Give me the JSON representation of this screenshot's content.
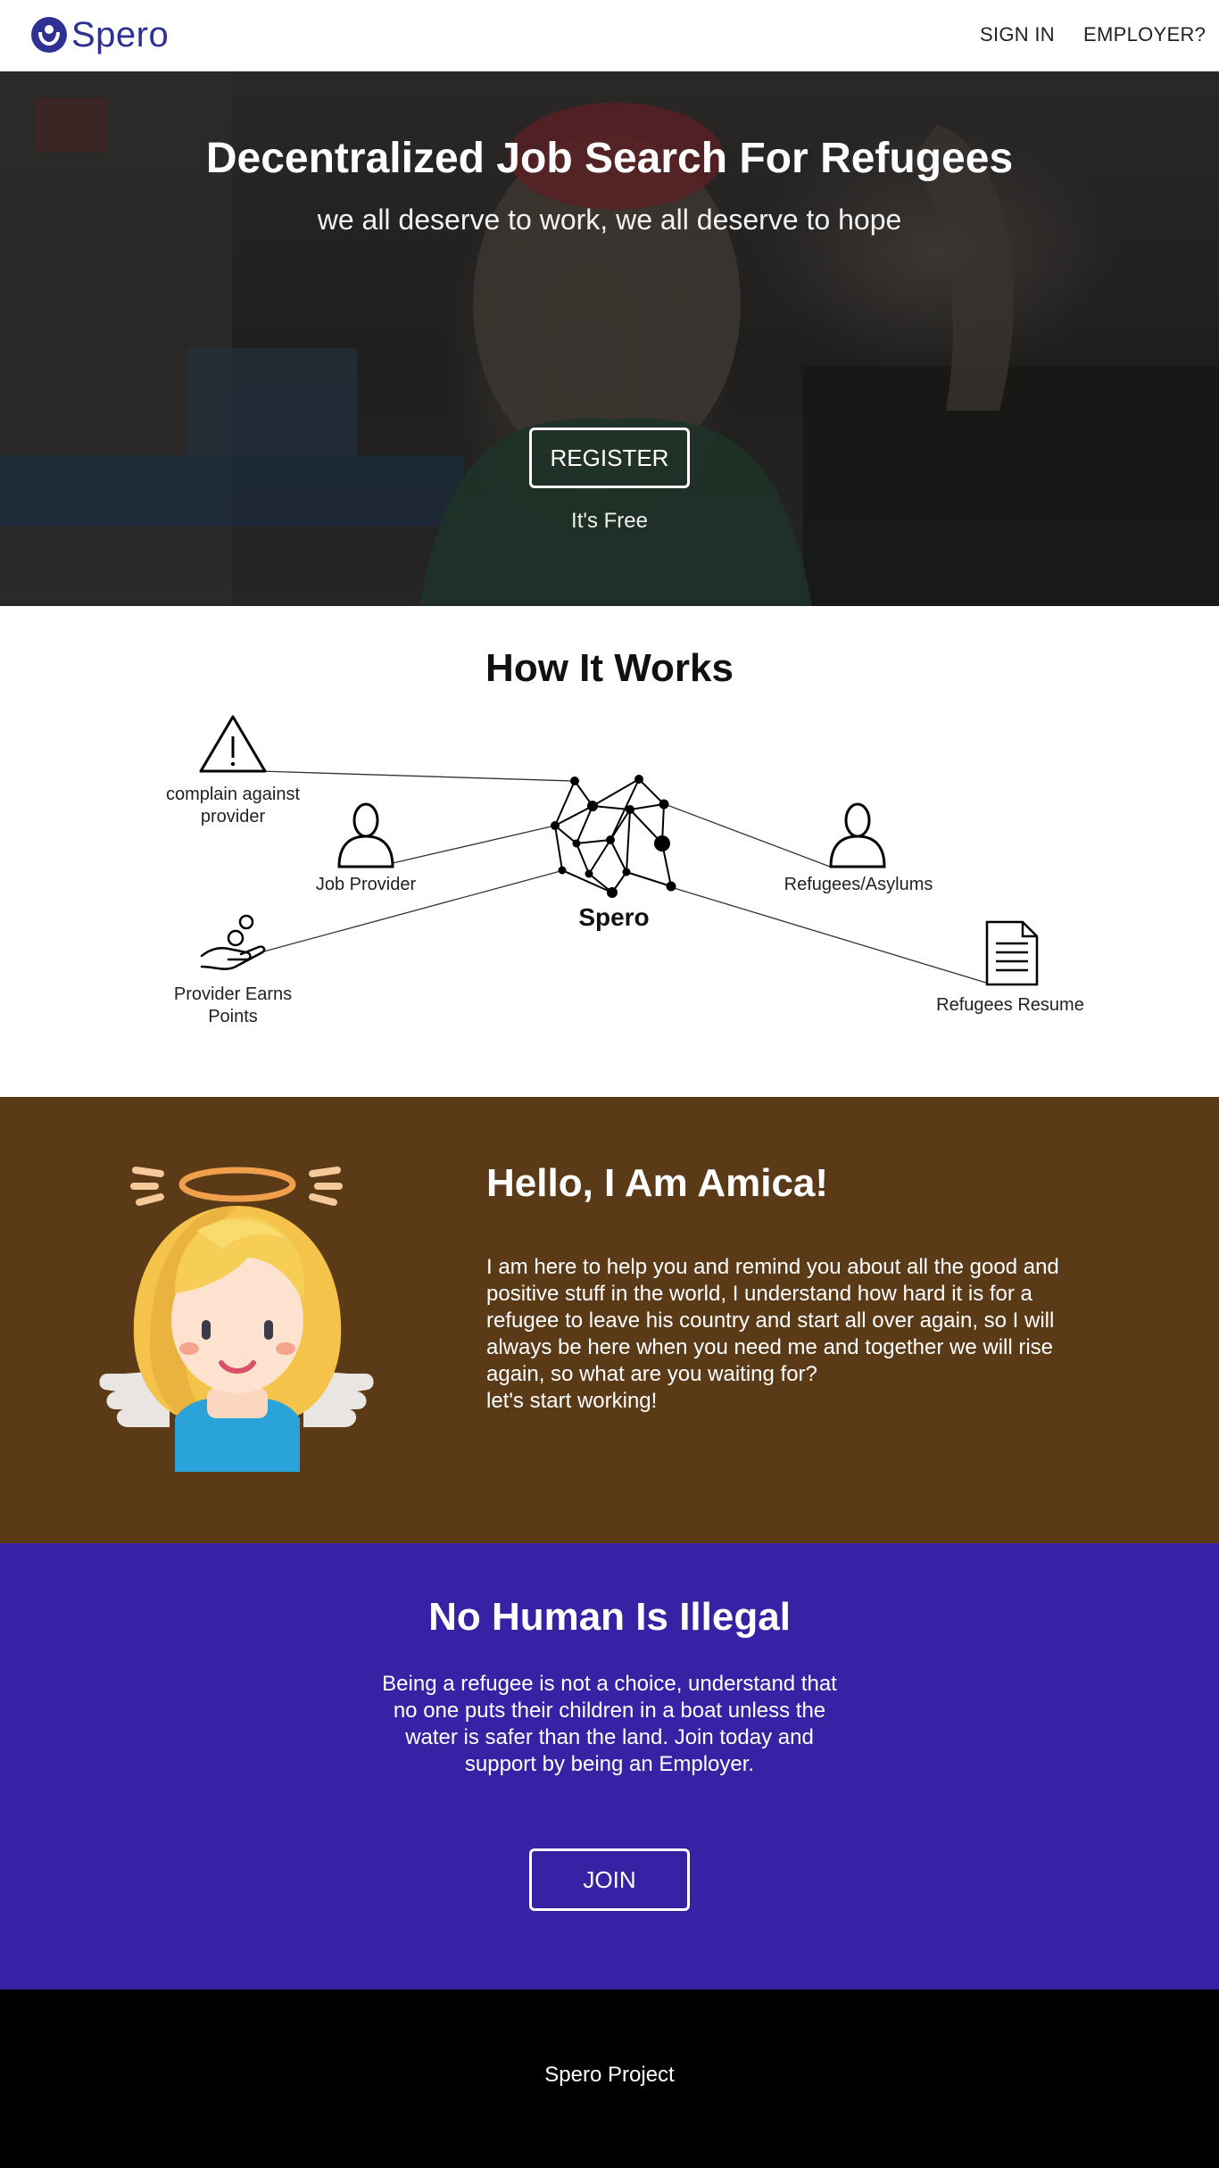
{
  "nav": {
    "brand": "Spero",
    "sign_in": "SIGN IN",
    "employer": "EMPLOYER?",
    "brand_color": "#2e3192"
  },
  "hero": {
    "title": "Decentralized Job Search For Refugees",
    "subtitle": "we all deserve to work, we all deserve to hope",
    "register_label": "REGISTER",
    "free_note": "It's Free"
  },
  "how": {
    "title": "How It Works",
    "center_label": "Spero",
    "nodes": {
      "complain": "complain against provider",
      "job_provider": "Job Provider",
      "earn_points": "Provider Earns Points",
      "refugees": "Refugees/Asylums",
      "resume": "Refugees Resume"
    },
    "icons": {
      "complain": "warning-triangle-icon",
      "job_provider": "person-icon",
      "earn_points": "hand-coin-icon",
      "refugees": "person-icon",
      "resume": "document-icon",
      "center": "network-icon"
    }
  },
  "amica": {
    "title": "Hello, I Am Amica!",
    "text": "I am here to help you and remind you about all the good and positive stuff in the world, I understand how hard it is for a refugee to leave his country and start all over again, so I will always be here when you need me and together we will rise again, so what are you waiting for?",
    "text2": "let's start working!",
    "bg_color": "#5b3a18"
  },
  "illegal": {
    "title": "No Human Is Illegal",
    "text": "Being a refugee is not a choice, understand that no one puts their children in a boat unless the water is safer than the land. Join today and support by being an Employer.",
    "join_label": "JOIN",
    "bg_color": "#3522a4"
  },
  "footer": {
    "text": "Spero Project"
  }
}
